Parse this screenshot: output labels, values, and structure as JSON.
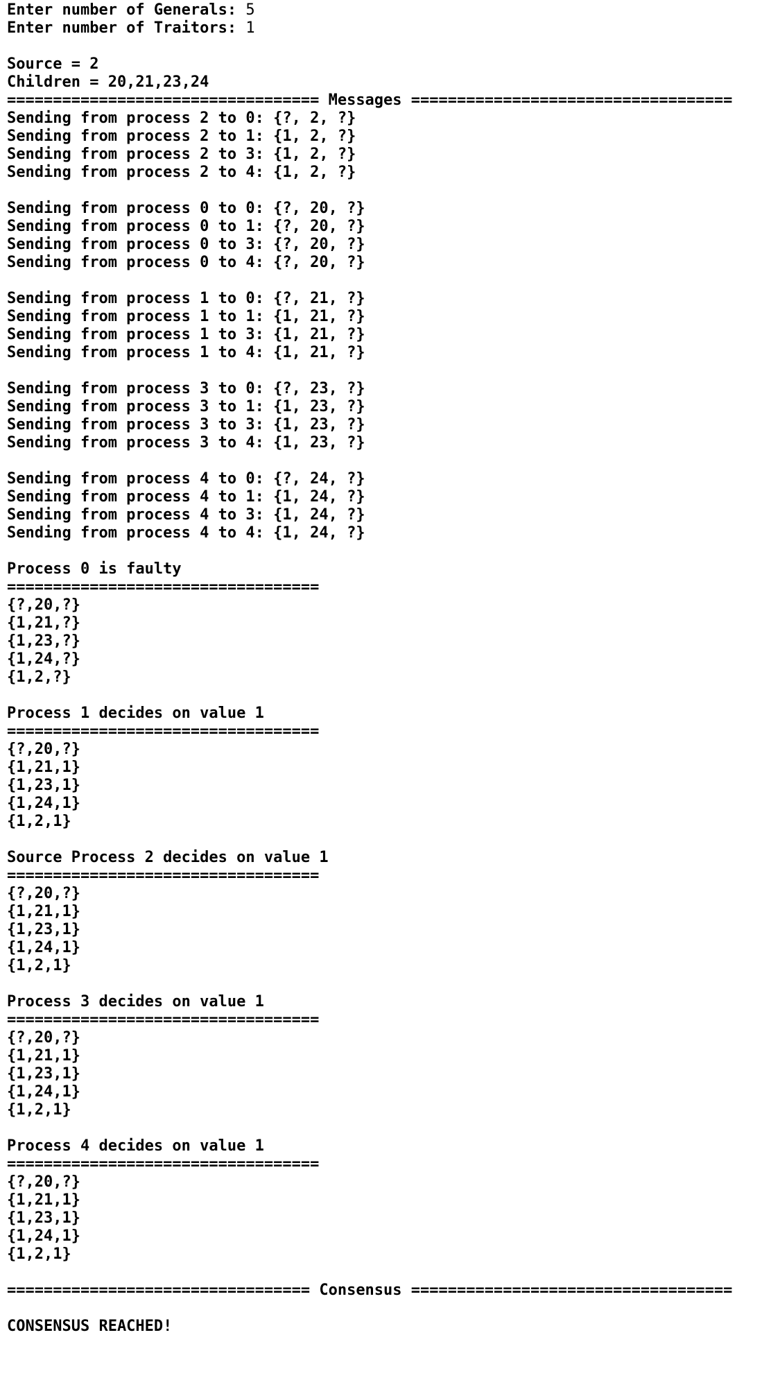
{
  "terminal": {
    "text_color": "#000000",
    "background": "#ffffff",
    "prompts": {
      "generals_label": "Enter number of Generals: ",
      "generals_value": "5",
      "traitors_label": "Enter number of Traitors: ",
      "traitors_value": "1"
    },
    "source_line": "Source = 2",
    "children_line": "Children = 20,21,23,24",
    "messages_header": "================================== Messages ===================================",
    "message_groups": [
      [
        "Sending from process 2 to 0: {?, 2, ?}",
        "Sending from process 2 to 1: {1, 2, ?}",
        "Sending from process 2 to 3: {1, 2, ?}",
        "Sending from process 2 to 4: {1, 2, ?}"
      ],
      [
        "Sending from process 0 to 0: {?, 20, ?}",
        "Sending from process 0 to 1: {?, 20, ?}",
        "Sending from process 0 to 3: {?, 20, ?}",
        "Sending from process 0 to 4: {?, 20, ?}"
      ],
      [
        "Sending from process 1 to 0: {?, 21, ?}",
        "Sending from process 1 to 1: {1, 21, ?}",
        "Sending from process 1 to 3: {1, 21, ?}",
        "Sending from process 1 to 4: {1, 21, ?}"
      ],
      [
        "Sending from process 3 to 0: {?, 23, ?}",
        "Sending from process 3 to 1: {1, 23, ?}",
        "Sending from process 3 to 3: {1, 23, ?}",
        "Sending from process 3 to 4: {1, 23, ?}"
      ],
      [
        "Sending from process 4 to 0: {?, 24, ?}",
        "Sending from process 4 to 1: {1, 24, ?}",
        "Sending from process 4 to 3: {1, 24, ?}",
        "Sending from process 4 to 4: {1, 24, ?}"
      ]
    ],
    "process_blocks": [
      {
        "title": "Process 0 is faulty",
        "rule": "==================================",
        "values": [
          "{?,20,?}",
          "{1,21,?}",
          "{1,23,?}",
          "{1,24,?}",
          "{1,2,?}"
        ]
      },
      {
        "title": "Process 1 decides on value 1",
        "rule": "==================================",
        "values": [
          "{?,20,?}",
          "{1,21,1}",
          "{1,23,1}",
          "{1,24,1}",
          "{1,2,1}"
        ]
      },
      {
        "title": "Source Process 2 decides on value 1",
        "rule": "==================================",
        "values": [
          "{?,20,?}",
          "{1,21,1}",
          "{1,23,1}",
          "{1,24,1}",
          "{1,2,1}"
        ]
      },
      {
        "title": "Process 3 decides on value 1",
        "rule": "==================================",
        "values": [
          "{?,20,?}",
          "{1,21,1}",
          "{1,23,1}",
          "{1,24,1}",
          "{1,2,1}"
        ]
      },
      {
        "title": "Process 4 decides on value 1",
        "rule": "==================================",
        "values": [
          "{?,20,?}",
          "{1,21,1}",
          "{1,23,1}",
          "{1,24,1}",
          "{1,2,1}"
        ]
      }
    ],
    "consensus_header": "================================= Consensus ===================================",
    "result_line": "CONSENSUS REACHED!"
  }
}
